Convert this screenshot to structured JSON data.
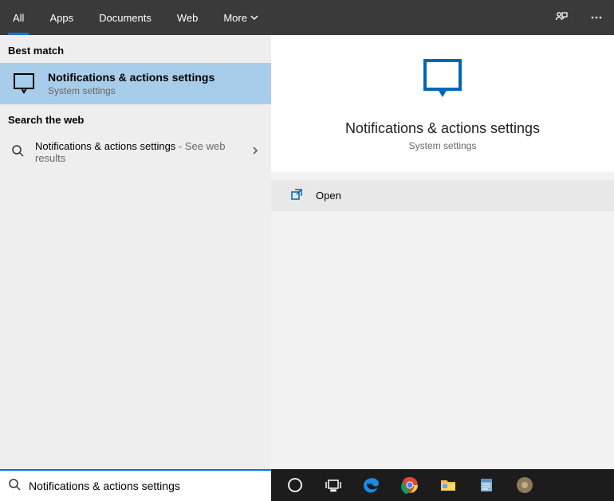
{
  "tabs": {
    "all": "All",
    "apps": "Apps",
    "documents": "Documents",
    "web": "Web",
    "more": "More"
  },
  "left": {
    "best_match_label": "Best match",
    "best_match": {
      "title": "Notifications & actions settings",
      "subtitle": "System settings"
    },
    "search_web_label": "Search the web",
    "web_result": {
      "primary": "Notifications & actions settings",
      "secondary": " - See web results"
    }
  },
  "preview": {
    "title": "Notifications & actions settings",
    "subtitle": "System settings",
    "open_label": "Open"
  },
  "search": {
    "value": "Notifications & actions settings"
  }
}
